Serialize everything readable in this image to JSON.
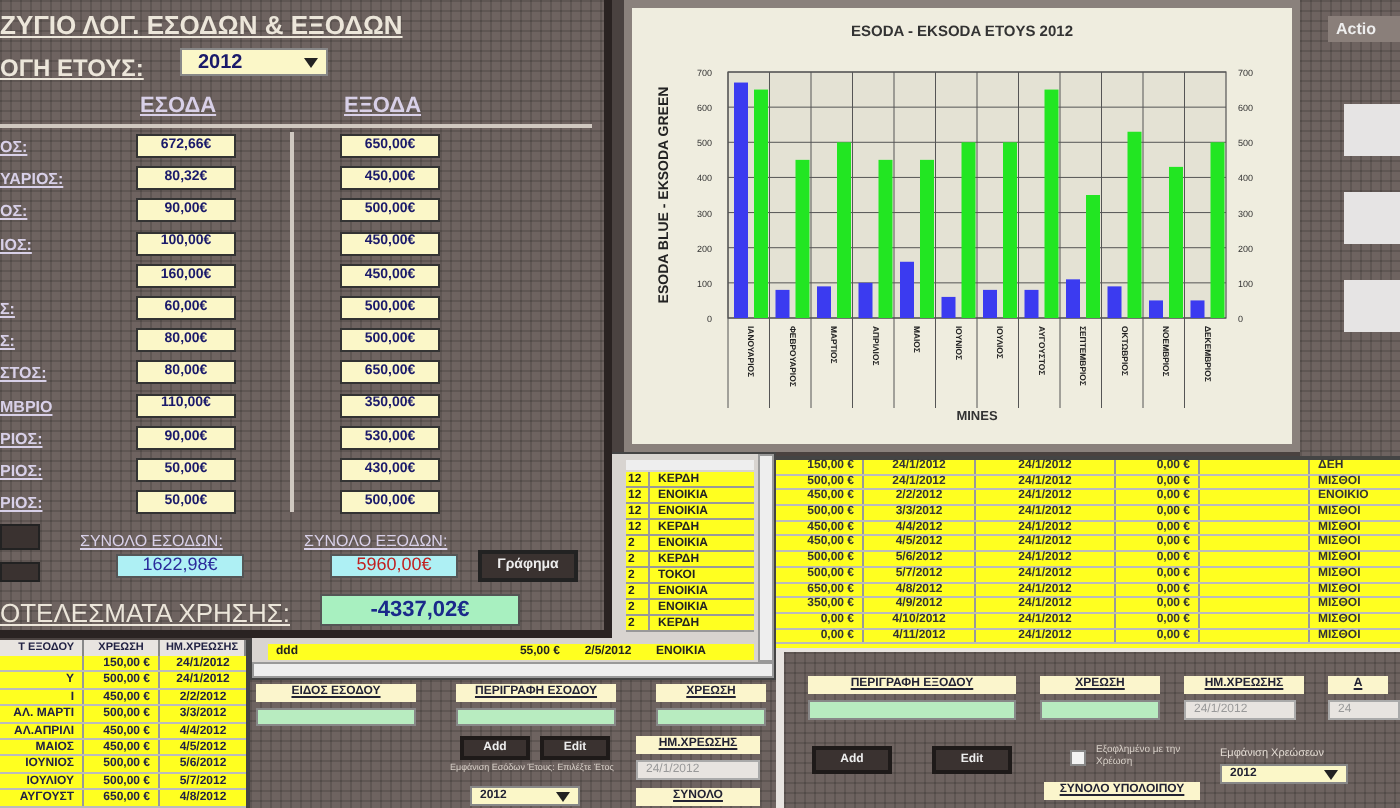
{
  "balance_window": {
    "title": "ΖΥΓΙΟ ΛΟΓ. ΕΣΟΔΩΝ & ΕΞΟΔΩΝ",
    "year_label": "ΟΓΗ ΕΤΟΥΣ:",
    "year_select": "2012",
    "income_header": "ΕΣΟΔΑ",
    "expense_header": "ΕΞΟΔΑ",
    "months": [
      {
        "label": "ΟΣ:",
        "income": "672,66€",
        "expense": "650,00€"
      },
      {
        "label": "ΥΑΡΙΟΣ:",
        "income": "80,32€",
        "expense": "450,00€"
      },
      {
        "label": "ΟΣ:",
        "income": "90,00€",
        "expense": "500,00€"
      },
      {
        "label": "ΙΟΣ:",
        "income": "100,00€",
        "expense": "450,00€"
      },
      {
        "income": "160,00€",
        "expense": "450,00€"
      },
      {
        "label": "Σ:",
        "income": "60,00€",
        "expense": "500,00€"
      },
      {
        "label": "Σ:",
        "income": "80,00€",
        "expense": "500,00€"
      },
      {
        "label": "ΣΤΟΣ:",
        "income": "80,00€",
        "expense": "650,00€"
      },
      {
        "label": "ΜΒΡΙΟ",
        "income": "110,00€",
        "expense": "350,00€"
      },
      {
        "label": "ΡΙΟΣ:",
        "income": "90,00€",
        "expense": "530,00€"
      },
      {
        "label": "ΡΙΟΣ:",
        "income": "50,00€",
        "expense": "430,00€"
      },
      {
        "label": "ΡΙΟΣ:",
        "income": "50,00€",
        "expense": "500,00€"
      }
    ],
    "total_income_label": "ΣΥΝΟΛΟ ΕΣΟΔΩΝ:",
    "total_income": "1622,98€",
    "total_expense_label": "ΣΥΝΟΛΟ ΕΞΟΔΩΝ:",
    "total_expense": "5960,00€",
    "chart_button": "Γράφημα",
    "result_label": "ΟΤΕΛΕΣΜΑΤΑ ΧΡΗΣΗΣ:",
    "result": "-4337,02€"
  },
  "chart_window": {
    "chart_data": {
      "type": "bar",
      "title": "ESODA - EKSODA ETOYS  2012",
      "xlabel": "MINES",
      "ylabel": "ESODA BLUE - EKSODA GREEN",
      "categories": [
        "ΙΑΝΟΥΑΡΙΟΣ",
        "ΦΕΒΡΟΥΑΡΙΟΣ",
        "ΜΑΡΤΙΟΣ",
        "ΑΠΡΙΛΙΟΣ",
        "ΜΑΙΟΣ",
        "ΙΟΥΝΙΟΣ",
        "ΙΟΥΛΙΟΣ",
        "ΑΥΓΟΥΣΤΟΣ",
        "ΣΕΠΤΕΜΒΡΙΟΣ",
        "ΟΚΤΩΒΡΙΟΣ",
        "ΝΟΕΜΒΡΙΟΣ",
        "ΔΕΚΕΜΒΡΙΟΣ"
      ],
      "series": [
        {
          "color": "#3b3bf0",
          "values": [
            670,
            80,
            90,
            100,
            160,
            60,
            80,
            80,
            110,
            90,
            50,
            50
          ]
        },
        {
          "color": "#22e622",
          "values": [
            650,
            450,
            500,
            450,
            450,
            500,
            500,
            650,
            350,
            530,
            430,
            500
          ]
        }
      ],
      "ylim": [
        0,
        700
      ],
      "yticks": [
        0,
        100,
        200,
        300,
        400,
        500,
        600,
        700
      ],
      "grid": true
    },
    "left_axis_ticks": [
      "700",
      "600",
      "500",
      "400",
      "300",
      "200",
      "100",
      "0"
    ],
    "right_axis_ticks": [
      "700",
      "600",
      "500",
      "400",
      "300",
      "200",
      "100",
      "0"
    ]
  },
  "side_panel": {
    "action_button": "Actio"
  },
  "income_table": {
    "rows": [
      {
        "column_1": "12",
        "column_2": "ΚΕΡΔΗ"
      },
      {
        "column_1": "12",
        "column_2": "ΕΝΟΙΚΙΑ"
      },
      {
        "column_1": "12",
        "column_2": "ΕΝΟΙΚΙΑ"
      },
      {
        "column_1": "12",
        "column_2": "ΚΕΡΔΗ"
      },
      {
        "column_1": "2",
        "column_2": "ΕΝΟΙΚΙΑ"
      },
      {
        "column_1": "2",
        "column_2": "ΚΕΡΔΗ"
      },
      {
        "column_1": "2",
        "column_2": "ΤΟΚΟΙ"
      },
      {
        "column_1": "2",
        "column_2": "ΕΝΟΙΚΙΑ"
      },
      {
        "column_1": "2",
        "column_2": "ΕΝΟΙΚΙΑ"
      },
      {
        "column_1": "2",
        "column_2": "ΚΕΡΔΗ"
      }
    ],
    "last_row": {
      "description": "ddd",
      "amount": "55,00 €",
      "date": "2/5/2012",
      "type": "ΕΝΟΙΚΙΑ"
    }
  },
  "expense_table": {
    "rows": [
      {
        "amount": "150,00 €",
        "date": "24/1/2012",
        "date_2": "24/1/2012",
        "paid": "0,00 €",
        "category": "ΔΕΗ"
      },
      {
        "amount": "500,00 €",
        "date": "24/1/2012",
        "date_2": "24/1/2012",
        "paid": "0,00 €",
        "category": "ΜΙΣΘΟΙ"
      },
      {
        "amount": "450,00 €",
        "date": "2/2/2012",
        "date_2": "24/1/2012",
        "paid": "0,00 €",
        "category": "ΕΝΟΙΚΙΟ"
      },
      {
        "amount": "500,00 €",
        "date": "3/3/2012",
        "date_2": "24/1/2012",
        "paid": "0,00 €",
        "category": "ΜΙΣΘΟΙ"
      },
      {
        "amount": "450,00 €",
        "date": "4/4/2012",
        "date_2": "24/1/2012",
        "paid": "0,00 €",
        "category": "ΜΙΣΘΟΙ"
      },
      {
        "amount": "450,00 €",
        "date": "4/5/2012",
        "date_2": "24/1/2012",
        "paid": "0,00 €",
        "category": "ΜΙΣΘΟΙ"
      },
      {
        "amount": "500,00 €",
        "date": "5/6/2012",
        "date_2": "24/1/2012",
        "paid": "0,00 €",
        "category": "ΜΙΣΘΟΙ"
      },
      {
        "amount": "500,00 €",
        "date": "5/7/2012",
        "date_2": "24/1/2012",
        "paid": "0,00 €",
        "category": "ΜΙΣΘΟΙ"
      },
      {
        "amount": "650,00 €",
        "date": "4/8/2012",
        "date_2": "24/1/2012",
        "paid": "0,00 €",
        "category": "ΜΙΣΘΟΙ"
      },
      {
        "amount": "350,00 €",
        "date": "4/9/2012",
        "date_2": "24/1/2012",
        "paid": "0,00 €",
        "category": "ΜΙΣΘΟΙ"
      },
      {
        "amount": "0,00 €",
        "date": "4/10/2012",
        "date_2": "24/1/2012",
        "paid": "0,00 €",
        "category": "ΜΙΣΘΟΙ"
      },
      {
        "amount": "0,00 €",
        "date": "4/11/2012",
        "date_2": "24/1/2012",
        "paid": "0,00 €",
        "category": "ΜΙΣΘΟΙ"
      }
    ]
  },
  "charges_table": {
    "columns": [
      "Τ ΕΞΟΔΟΥ",
      "ΧΡΕΩΣΗ",
      "ΗΜ.ΧΡΕΩΣΗΣ"
    ],
    "rows": [
      {
        "amount": "150,00 €",
        "date": "24/1/2012"
      },
      {
        "name": "Υ",
        "amount": "500,00 €",
        "date": "24/1/2012"
      },
      {
        "name": "Ι",
        "amount": "450,00 €",
        "date": "2/2/2012"
      },
      {
        "name": "ΑΛ. ΜΑΡΤΙ",
        "amount": "500,00 €",
        "date": "3/3/2012"
      },
      {
        "name": "ΑΛ.ΑΠΡΙΛΙ",
        "amount": "450,00 €",
        "date": "4/4/2012"
      },
      {
        "name": "ΜΑΙΟΣ",
        "amount": "450,00 €",
        "date": "4/5/2012"
      },
      {
        "name": "ΙΟΥΝΙΟΣ",
        "amount": "500,00 €",
        "date": "5/6/2012"
      },
      {
        "name": "ΙΟΥΛΙΟΥ",
        "amount": "500,00 €",
        "date": "5/7/2012"
      },
      {
        "name": "ΑΥΓΟΥΣΤ",
        "amount": "650,00 €",
        "date": "4/8/2012"
      }
    ]
  },
  "income_form": {
    "labels": [
      "ΕΙΔΟΣ ΕΣΟΔΟΥ",
      "ΠΕΡΙΓΡΑΦΗ ΕΣΟΔΟΥ",
      "ΧΡΕΩΣΗ"
    ],
    "add_button": "Add",
    "edit_button": "Edit",
    "date_label": "ΗΜ.ΧΡΕΩΣΗΣ",
    "date": "24/1/2012",
    "year_caption": "Εμφάνιση Εσόδων Έτους: Επιλέξτε Έτος",
    "year": "2012",
    "total_label": "ΣΥΝΟΛΟ"
  },
  "expense_form": {
    "labels": [
      "ΠΕΡΙΓΡΑΦΗ ΕΞΟΔΟΥ",
      "ΧΡΕΩΣΗ",
      "ΗΜ.ΧΡΕΩΣΗΣ",
      "Α"
    ],
    "date": "24/1/2012",
    "date_2": "24",
    "add_button": "Add",
    "edit_button": "Edit",
    "paid_checkbox": {
      "label": "Εξοφλημένο με την Χρέωση",
      "checked": false
    },
    "year_caption": "Εμφάνιση Χρεώσεων",
    "year": "2012",
    "total_label": "ΣΥΝΟΛΟ ΥΠΟΛΟΙΠΟΥ"
  }
}
